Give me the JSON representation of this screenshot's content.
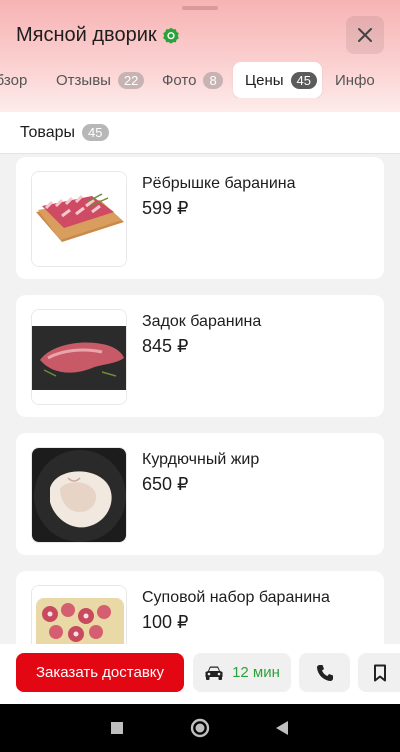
{
  "header": {
    "title": "Мясной дворик",
    "verified_icon": "verified-badge-icon",
    "close_icon": "close-icon"
  },
  "tabs": [
    {
      "label": "Обзор",
      "count": ""
    },
    {
      "label": "Отзывы",
      "count": "22"
    },
    {
      "label": "Фото",
      "count": "8"
    },
    {
      "label": "Цены",
      "count": "45",
      "active": true
    },
    {
      "label": "Инфо",
      "count": ""
    }
  ],
  "section": {
    "label": "Товары",
    "count": "45"
  },
  "products": [
    {
      "name": "Рёбрышке баранина",
      "price": "599 ₽"
    },
    {
      "name": "Задок баранина",
      "price": "845 ₽"
    },
    {
      "name": "Курдючный жир",
      "price": "650 ₽"
    },
    {
      "name": "Суповой набор баранина",
      "price": "100 ₽"
    }
  ],
  "bottom_bar": {
    "order_label": "Заказать доставку",
    "delivery_time": "12 мин",
    "car_icon": "car-icon",
    "phone_icon": "phone-icon",
    "bookmark_icon": "bookmark-icon"
  },
  "colors": {
    "accent_red": "#e30613",
    "delivery_green": "#2ca33a",
    "verified_green": "#2ca33a"
  }
}
